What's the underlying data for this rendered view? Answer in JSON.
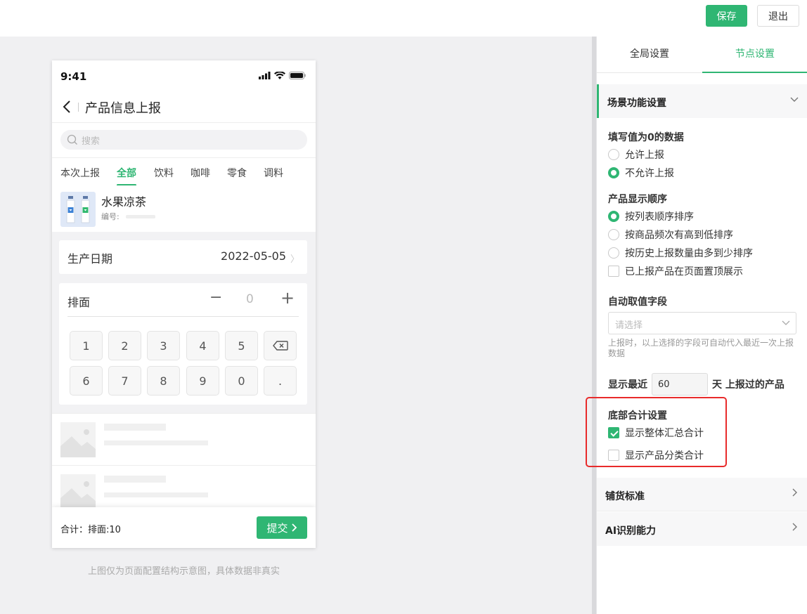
{
  "toolbar": {
    "save_label": "保存",
    "exit_label": "退出"
  },
  "phone": {
    "status_time": "9:41",
    "nav_title": "产品信息上报",
    "search_placeholder": "搜索",
    "tabs": [
      {
        "label": "本次上报",
        "active": false
      },
      {
        "label": "全部",
        "active": true
      },
      {
        "label": "饮料",
        "active": false
      },
      {
        "label": "咖啡",
        "active": false
      },
      {
        "label": "零食",
        "active": false
      },
      {
        "label": "调料",
        "active": false
      }
    ],
    "product": {
      "name": "水果凉茶",
      "code_label": "编号:"
    },
    "date": {
      "label": "生产日期",
      "value": "2022-05-05"
    },
    "quantity": {
      "label": "排面",
      "minus": "−",
      "value": "0",
      "plus": "+"
    },
    "keypad": [
      "1",
      "2",
      "3",
      "4",
      "5",
      "",
      "6",
      "7",
      "8",
      "9",
      "0",
      "."
    ],
    "footer": {
      "total": "合计：排面:10",
      "submit": "提交"
    },
    "caption": "上图仅为页面配置结构示意图，具体数据非真实"
  },
  "panel": {
    "tabs": [
      {
        "label": "全局设置",
        "active": false
      },
      {
        "label": "节点设置",
        "active": true
      }
    ],
    "scene_section": "场景功能设置",
    "zero_value": {
      "title": "填写值为0的数据",
      "options": [
        {
          "label": "允许上报",
          "selected": false
        },
        {
          "label": "不允许上报",
          "selected": true
        }
      ]
    },
    "display_order": {
      "title": "产品显示顺序",
      "options": [
        {
          "label": "按列表顺序排序",
          "selected": true
        },
        {
          "label": "按商品频次有高到低排序",
          "selected": false
        },
        {
          "label": "按历史上报数量由多到少排序",
          "selected": false
        }
      ],
      "pin_reported": {
        "label": "已上报产品在页面置顶展示",
        "checked": false
      }
    },
    "auto_field": {
      "title": "自动取值字段",
      "placeholder": "请选择",
      "hint": "上报时，以上选择的字段可自动代入最近一次上报数据"
    },
    "recent_days": {
      "prefix": "显示最近",
      "value": "60",
      "suffix": "天 上报过的产品"
    },
    "bottom_total": {
      "title": "底部合计设置",
      "overall": {
        "label": "显示整体汇总合计",
        "checked": true
      },
      "category": {
        "label": "显示产品分类合计",
        "checked": false
      }
    },
    "sections": [
      "铺货标准",
      "AI识别能力"
    ]
  },
  "colors": {
    "accent": "#2fb673",
    "highlight": "#e82b2b"
  }
}
